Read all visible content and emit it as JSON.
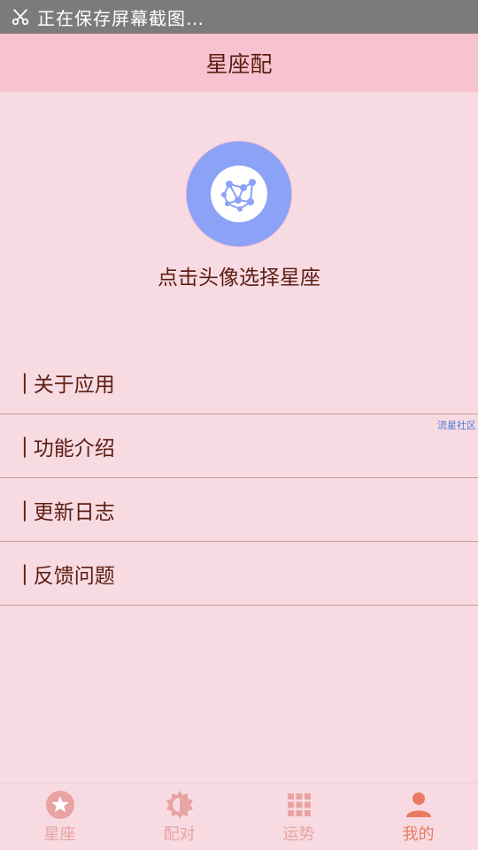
{
  "status_bar": {
    "text": "正在保存屏幕截图…",
    "icon": "scissors-icon"
  },
  "app_bar": {
    "title": "星座配"
  },
  "profile": {
    "avatar_icon": "network-icon",
    "hint": "点击头像选择星座"
  },
  "menu": {
    "items": [
      {
        "label": "关于应用"
      },
      {
        "label": "功能介绍"
      },
      {
        "label": "更新日志"
      },
      {
        "label": "反馈问题"
      }
    ]
  },
  "side_link": {
    "label": "流星社区"
  },
  "tabs": [
    {
      "label": "星座",
      "icon": "star-icon",
      "active": false
    },
    {
      "label": "配对",
      "icon": "sun-icon",
      "active": false
    },
    {
      "label": "运势",
      "icon": "grid-icon",
      "active": false
    },
    {
      "label": "我的",
      "icon": "person-icon",
      "active": true
    }
  ],
  "colors": {
    "background": "#f8dbe2",
    "app_bar": "#f8c3d0",
    "text": "#5b1d12",
    "tab_inactive": "#e8a3a3",
    "tab_active": "#e87a62",
    "avatar": "#8ba2f6"
  }
}
